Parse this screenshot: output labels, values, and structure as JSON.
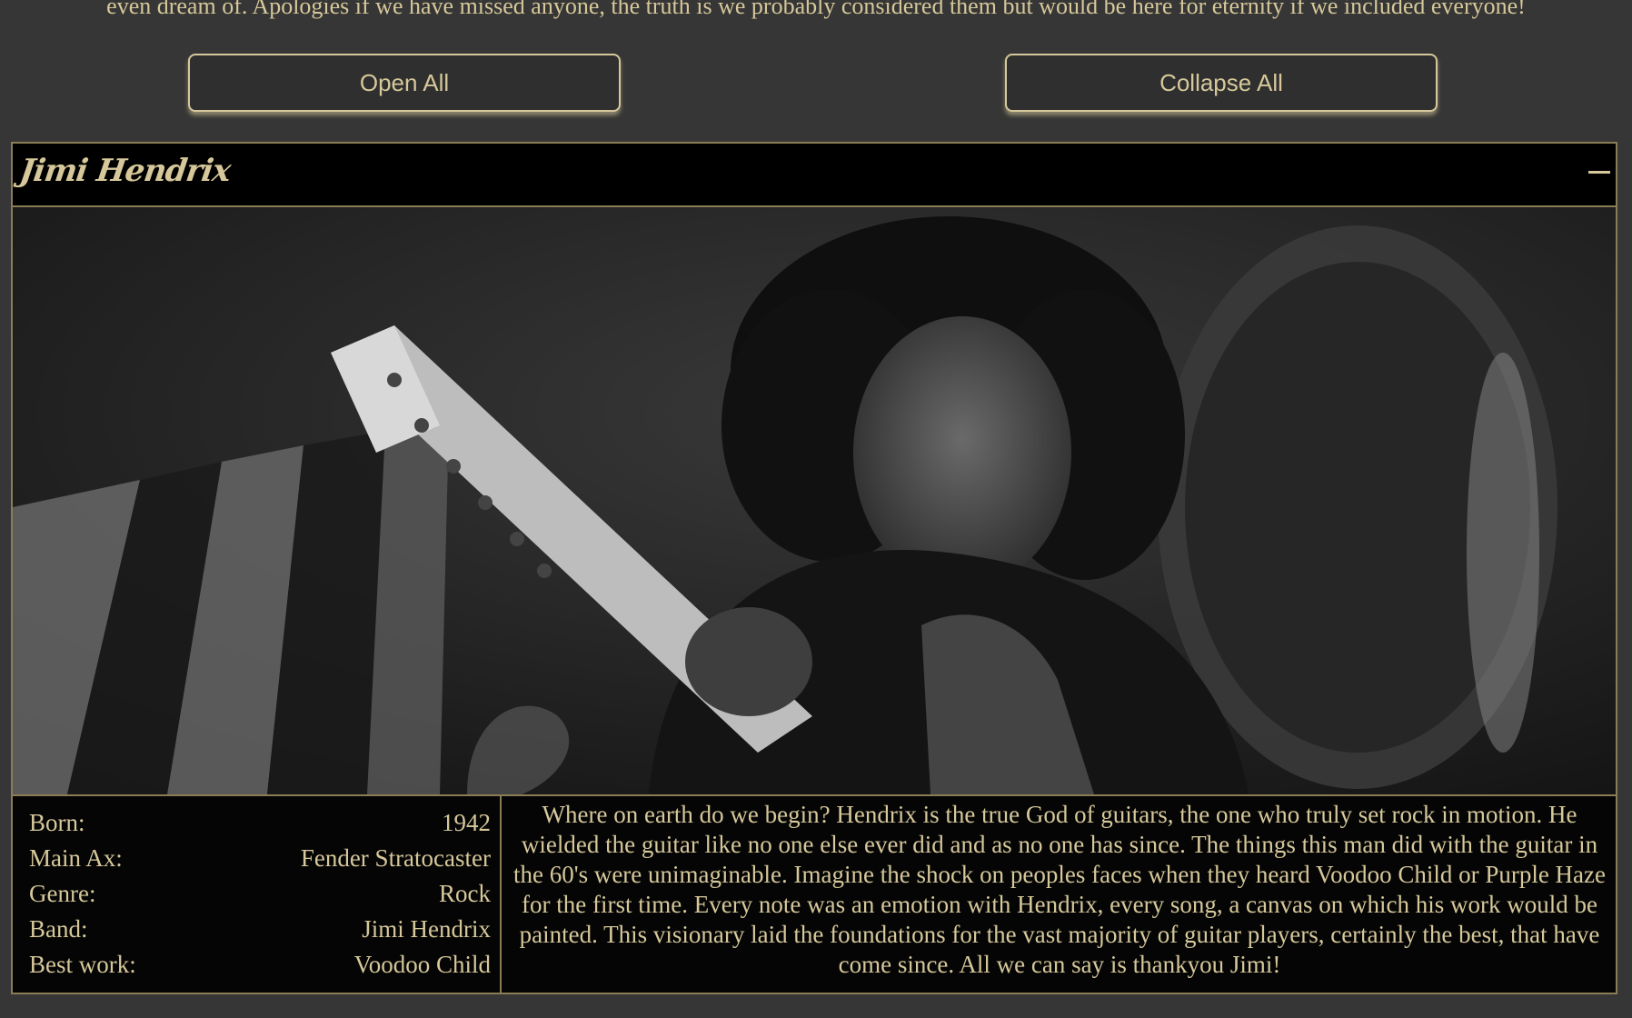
{
  "intro_text": "even dream of. Apologies if we have missed anyone, the truth is we probably considered them but would be here for eternity if we included everyone!",
  "controls": {
    "open_all_label": "Open All",
    "collapse_all_label": "Collapse All"
  },
  "accordion": {
    "title": "Jimi Hendrix",
    "toggle_icon": "minus-icon",
    "photo_alt": "Jimi Hendrix",
    "stats": [
      {
        "label": "Born:",
        "value": "1942"
      },
      {
        "label": "Main Ax:",
        "value": "Fender Stratocaster"
      },
      {
        "label": "Genre:",
        "value": "Rock"
      },
      {
        "label": "Band:",
        "value": "Jimi Hendrix"
      },
      {
        "label": "Best work:",
        "value": "Voodoo Child"
      }
    ],
    "description": "Where on earth do we begin? Hendrix is the true God of guitars, the one who truly set rock in motion. He wielded the guitar like no one else ever did and as no one has since. The things this man did with the guitar in the 60's were unimaginable. Imagine the shock on peoples faces when they heard Voodoo Child or Purple Haze for the first time. Every note was an emotion with Hendrix, every song, a canvas on which his work would be painted. This visionary laid the foundations for the vast majority of guitar players, certainly the best, that have come since. All we can say is thankyou Jimi!"
  },
  "colors": {
    "background": "#363636",
    "accent_text": "#d6c89a",
    "border": "#8a7d56",
    "panel_bg": "#000000"
  }
}
